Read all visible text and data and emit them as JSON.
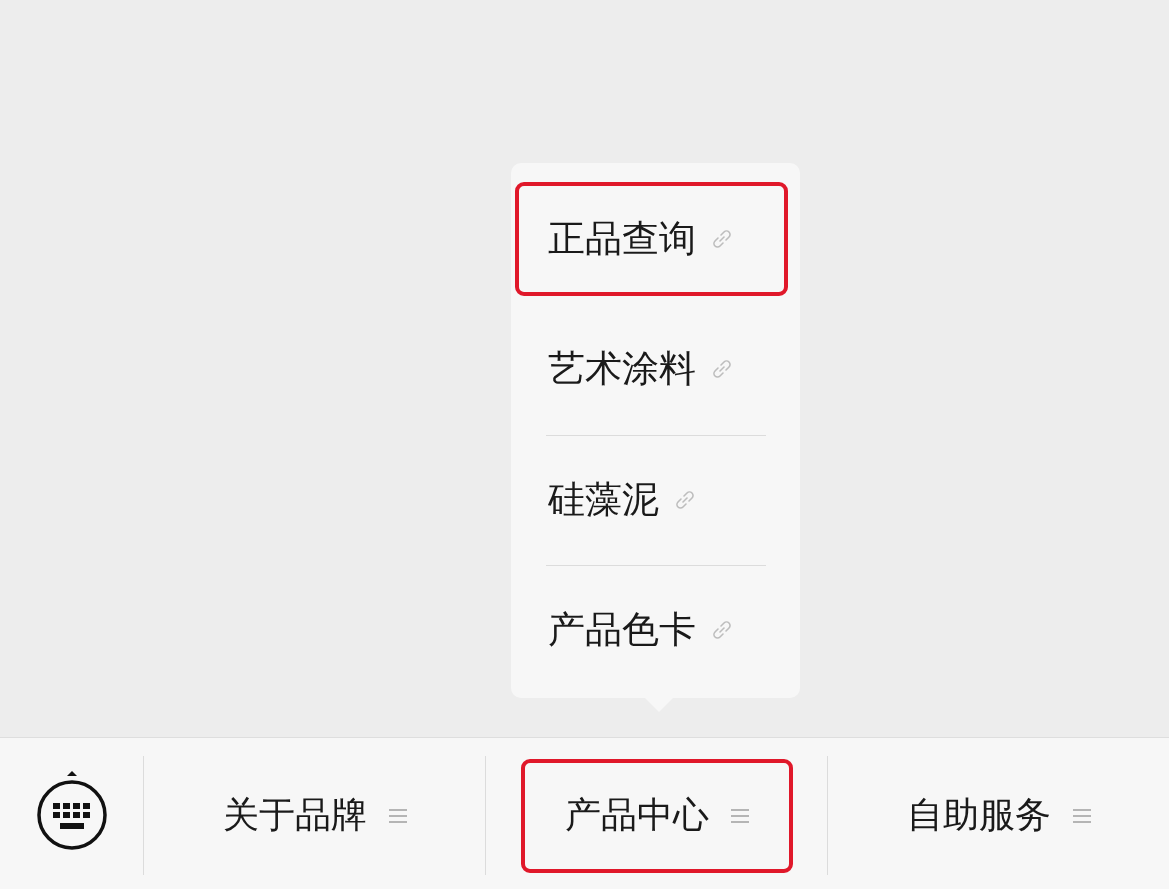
{
  "menus": [
    {
      "label": "关于品牌",
      "highlighted": false
    },
    {
      "label": "产品中心",
      "highlighted": true,
      "expanded": true,
      "submenu": [
        {
          "label": "正品查询",
          "highlighted": true
        },
        {
          "label": "艺术涂料",
          "highlighted": false
        },
        {
          "label": "硅藻泥",
          "highlighted": false
        },
        {
          "label": "产品色卡",
          "highlighted": false
        }
      ]
    },
    {
      "label": "自助服务",
      "highlighted": false
    }
  ]
}
